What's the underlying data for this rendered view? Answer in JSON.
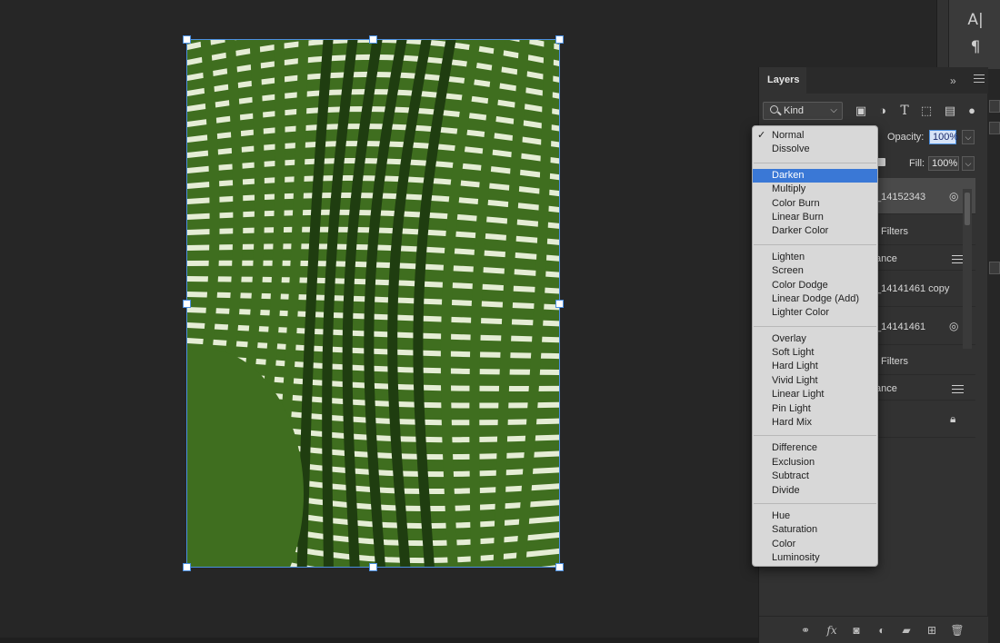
{
  "tool_strip": {
    "icons": [
      "type-tool-icon",
      "paragraph-icon"
    ],
    "glyphs": [
      "A|",
      "¶"
    ]
  },
  "layers_panel": {
    "tab_label": "Layers",
    "collapse_glyph": "»",
    "filter": {
      "label": "Kind",
      "filter_icons": [
        "image-filter-icon",
        "adjustment-filter-icon",
        "type-filter-icon",
        "shape-filter-icon",
        "smart-object-filter-icon",
        "filter-toggle-icon"
      ]
    },
    "opacity": {
      "label": "Opacity:",
      "value": "100%"
    },
    "fill": {
      "label": "Fill:",
      "value": "100%"
    },
    "layers": [
      {
        "name": "_14152343",
        "kind": "smart-object",
        "selected": true
      },
      {
        "name": "Filters",
        "kind": "smart-filters"
      },
      {
        "name": "ance",
        "kind": "filter-entry"
      },
      {
        "name": "_14141461 copy",
        "kind": "layer"
      },
      {
        "name": "_14141461",
        "kind": "smart-object"
      },
      {
        "name": "Filters",
        "kind": "smart-filters"
      },
      {
        "name": "ance",
        "kind": "filter-entry"
      },
      {
        "name": "",
        "kind": "background-locked"
      }
    ],
    "footer_icons": [
      "link-layers-icon",
      "fx-icon",
      "layer-mask-icon",
      "adjustment-layer-icon",
      "group-folder-icon",
      "new-layer-icon",
      "trash-icon"
    ]
  },
  "blend_menu": {
    "selected": "Normal",
    "highlighted": "Darken",
    "groups": [
      [
        "Normal",
        "Dissolve"
      ],
      [
        "Darken",
        "Multiply",
        "Color Burn",
        "Linear Burn",
        "Darker Color"
      ],
      [
        "Lighten",
        "Screen",
        "Color Dodge",
        "Linear Dodge (Add)",
        "Lighter Color"
      ],
      [
        "Overlay",
        "Soft Light",
        "Hard Light",
        "Vivid Light",
        "Linear Light",
        "Pin Light",
        "Hard Mix"
      ],
      [
        "Difference",
        "Exclusion",
        "Subtract",
        "Divide"
      ],
      [
        "Hue",
        "Saturation",
        "Color",
        "Luminosity"
      ]
    ]
  },
  "colors": {
    "artwork_green": "#3f6e1f",
    "artwork_dark": "#1f3d10",
    "artwork_light": "#eef3df",
    "selection_blue": "#3a78d6",
    "frame_blue": "#4b8fe0"
  }
}
